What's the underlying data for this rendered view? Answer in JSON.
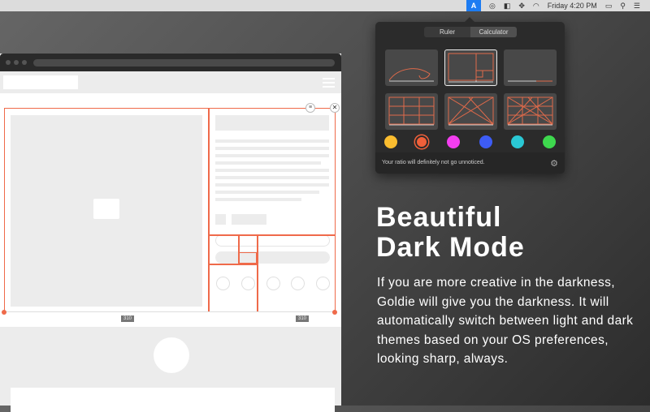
{
  "menubar": {
    "clock": "Friday 4:20 PM",
    "app_icon": "A",
    "icons": [
      "goldie-app-icon",
      "creative-cloud-icon",
      "sidebar-icon",
      "dropbox-icon",
      "wifi-icon",
      "battery-icon",
      "search-icon",
      "list-icon"
    ]
  },
  "popover": {
    "tabs": [
      {
        "label": "Ruler"
      },
      {
        "label": "Calculator"
      }
    ],
    "footer": "Your ratio will definitely not go unnoticed.",
    "colors": [
      "#fbbd2f",
      "#f0603a",
      "#f43ef0",
      "#3d5cf5",
      "#2ac8d4",
      "#3ed84e"
    ]
  },
  "browser": {
    "dimension_labels": [
      "310",
      "310"
    ]
  },
  "hero": {
    "title_line1": "Beautiful",
    "title_line2": "Dark Mode",
    "body": "If you are more creative in the darkness, Goldie will give you the darkness. It will automatically switch between light and dark themes based on your OS preferences, looking sharp, always."
  }
}
